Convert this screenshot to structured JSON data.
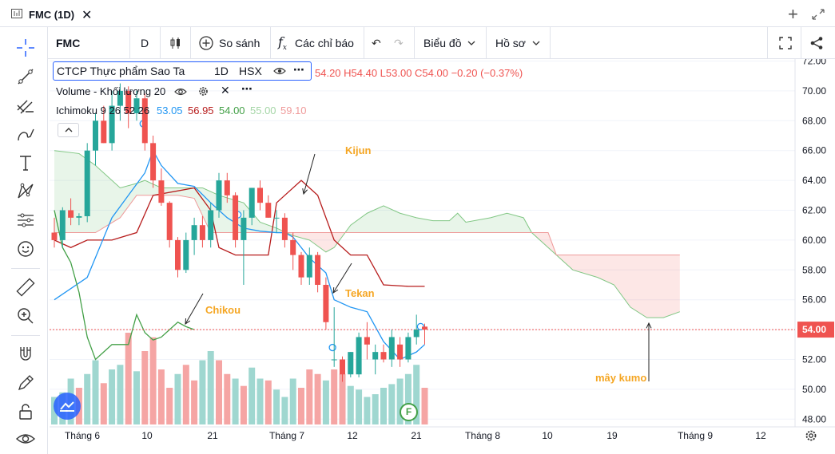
{
  "window": {
    "title": "FMC (1D)"
  },
  "toolbar": {
    "symbol": "FMC",
    "interval": "D",
    "compare": "So sánh",
    "indicators": "Các chỉ báo",
    "chart_type": "Biểu đồ",
    "profile": "Hồ sơ"
  },
  "legend": {
    "name": "CTCP Thực phẩm Sao Ta",
    "interval": "1D",
    "exchange": "HSX",
    "ohlc": "54.20  H54.40  L53.00  C54.00  −0.20 (−0.37%)",
    "volume_label": "Volume - Khối lượng 20",
    "ichimoku_label": "Ichimoku 9 26 52 26",
    "ichimoku_values": [
      "53.05",
      "56.95",
      "54.00",
      "55.00",
      "59.10"
    ]
  },
  "annotations": {
    "kijun": "Kijun",
    "tekan": "Tekan",
    "chikou": "Chikou",
    "kumo": "mây kumo"
  },
  "colors": {
    "up": "#26a69a",
    "down": "#ef5350",
    "tenkan": "#2196f3",
    "kijun": "#b71c1c",
    "chikou": "#43a047",
    "span_a": "#81c784",
    "span_b": "#ef9a9a",
    "annotation": "#f5a623"
  },
  "chart_data": {
    "type": "candlestick",
    "y_range": [
      47.5,
      72.2
    ],
    "y_ticks": [
      "72.00",
      "70.00",
      "68.00",
      "66.00",
      "64.00",
      "62.00",
      "60.00",
      "58.00",
      "56.00",
      "54.00",
      "52.00",
      "50.00",
      "48.00"
    ],
    "x_ticks": [
      "Tháng 6",
      "10",
      "21",
      "Tháng 7",
      "12",
      "21",
      "Tháng 8",
      "10",
      "19",
      "Tháng 9",
      "12"
    ],
    "last_price": "54.00",
    "candles": [
      [
        60.5,
        61.5,
        59.5,
        60.0
      ],
      [
        60.0,
        62.2,
        59.5,
        62.0
      ],
      [
        62.0,
        62.8,
        61.0,
        61.5
      ],
      [
        61.5,
        61.8,
        61.0,
        61.6
      ],
      [
        61.6,
        66.5,
        61.2,
        66.0
      ],
      [
        66.0,
        68.5,
        65.0,
        68.0
      ],
      [
        68.0,
        69.0,
        66.5,
        66.5
      ],
      [
        66.5,
        70.0,
        66.0,
        69.0
      ],
      [
        69.0,
        70.5,
        68.0,
        70.0
      ],
      [
        70.0,
        70.3,
        67.5,
        68.5
      ],
      [
        68.5,
        70.0,
        68.0,
        69.5
      ],
      [
        69.5,
        69.8,
        66.0,
        66.5
      ],
      [
        66.5,
        67.0,
        63.5,
        64.0
      ],
      [
        64.0,
        64.8,
        62.3,
        62.5
      ],
      [
        62.5,
        62.6,
        59.5,
        60.0
      ],
      [
        60.0,
        60.2,
        57.5,
        58.0
      ],
      [
        58.0,
        60.5,
        57.8,
        60.0
      ],
      [
        60.0,
        61.5,
        59.0,
        61.0
      ],
      [
        61.0,
        61.6,
        59.5,
        60.0
      ],
      [
        60.0,
        62.5,
        59.5,
        62.0
      ],
      [
        62.0,
        64.5,
        61.5,
        64.0
      ],
      [
        64.0,
        64.5,
        62.5,
        63.0
      ],
      [
        63.0,
        63.2,
        59.5,
        60.0
      ],
      [
        60.0,
        62.0,
        57.0,
        61.5
      ],
      [
        61.5,
        63.5,
        61.0,
        63.5
      ],
      [
        63.5,
        64.0,
        62.0,
        62.5
      ],
      [
        62.5,
        63.0,
        61.5,
        61.5
      ],
      [
        61.5,
        62.0,
        60.5,
        61.5
      ],
      [
        61.5,
        61.8,
        59.5,
        60.0
      ],
      [
        60.0,
        60.5,
        58.0,
        59.0
      ],
      [
        59.0,
        59.2,
        57.0,
        57.5
      ],
      [
        57.5,
        59.5,
        57.0,
        59.0
      ],
      [
        59.0,
        59.2,
        56.5,
        57.0
      ],
      [
        57.0,
        57.5,
        54.0,
        54.5
      ],
      [
        52.0,
        55.5,
        51.5,
        52.0
      ],
      [
        52.0,
        52.2,
        50.5,
        51.0
      ],
      [
        51.0,
        52.5,
        50.8,
        52.5
      ],
      [
        51.0,
        53.8,
        50.8,
        53.5
      ],
      [
        53.5,
        54.5,
        52.0,
        53.0
      ],
      [
        52.0,
        53.0,
        51.0,
        52.5
      ],
      [
        52.5,
        53.0,
        51.8,
        52.0
      ],
      [
        52.0,
        54.0,
        51.5,
        53.5
      ],
      [
        53.0,
        53.5,
        51.5,
        52.0
      ],
      [
        52.0,
        53.8,
        51.8,
        53.5
      ],
      [
        53.5,
        55.0,
        53.0,
        54.0
      ],
      [
        54.2,
        54.4,
        53.0,
        54.0
      ]
    ],
    "volume": [
      [
        30,
        1
      ],
      [
        35,
        1
      ],
      [
        50,
        1
      ],
      [
        40,
        0
      ],
      [
        55,
        1
      ],
      [
        70,
        1
      ],
      [
        45,
        0
      ],
      [
        60,
        1
      ],
      [
        65,
        1
      ],
      [
        100,
        0
      ],
      [
        58,
        1
      ],
      [
        80,
        0
      ],
      [
        95,
        0
      ],
      [
        60,
        0
      ],
      [
        40,
        0
      ],
      [
        55,
        1
      ],
      [
        65,
        0
      ],
      [
        48,
        0
      ],
      [
        70,
        1
      ],
      [
        80,
        1
      ],
      [
        70,
        0
      ],
      [
        55,
        0
      ],
      [
        50,
        1
      ],
      [
        42,
        0
      ],
      [
        62,
        1
      ],
      [
        50,
        1
      ],
      [
        48,
        0
      ],
      [
        38,
        1
      ],
      [
        30,
        1
      ],
      [
        50,
        1
      ],
      [
        40,
        0
      ],
      [
        60,
        0
      ],
      [
        55,
        0
      ],
      [
        48,
        1
      ],
      [
        60,
        0
      ],
      [
        55,
        0
      ],
      [
        42,
        1
      ],
      [
        38,
        1
      ],
      [
        30,
        1
      ],
      [
        33,
        1
      ],
      [
        40,
        1
      ],
      [
        44,
        1
      ],
      [
        50,
        1
      ],
      [
        55,
        1
      ],
      [
        65,
        1
      ],
      [
        40,
        0
      ]
    ],
    "tenkan": [
      [
        0,
        56.0
      ],
      [
        4,
        57.5
      ],
      [
        7,
        61.5
      ],
      [
        9,
        63.0
      ],
      [
        11,
        64.5
      ],
      [
        12,
        66.0
      ],
      [
        13,
        65.0
      ],
      [
        15,
        63.8
      ],
      [
        17,
        63.6
      ],
      [
        19,
        62.5
      ],
      [
        21,
        61.5
      ],
      [
        23,
        60.8
      ],
      [
        25,
        60.6
      ],
      [
        27,
        60.5
      ],
      [
        28,
        60.5
      ],
      [
        29,
        60.2
      ],
      [
        31,
        58.8
      ],
      [
        33,
        57.8
      ],
      [
        34,
        56.0
      ],
      [
        36,
        55.5
      ],
      [
        38,
        55.2
      ],
      [
        40,
        53.2
      ],
      [
        42,
        52.0
      ],
      [
        44,
        52.5
      ],
      [
        45,
        53.0
      ]
    ],
    "kijun": [
      [
        0,
        60.0
      ],
      [
        2,
        59.5
      ],
      [
        4,
        60.0
      ],
      [
        7,
        60.0
      ],
      [
        10,
        60.5
      ],
      [
        12,
        63.0
      ],
      [
        17,
        63.5
      ],
      [
        19,
        62.0
      ],
      [
        20,
        59.5
      ],
      [
        22,
        59.0
      ],
      [
        26,
        59.0
      ],
      [
        27,
        62.5
      ],
      [
        28,
        63.0
      ],
      [
        30,
        64.0
      ],
      [
        32,
        63.0
      ],
      [
        34,
        60.0
      ],
      [
        36,
        59.0
      ],
      [
        38,
        59.0
      ],
      [
        40,
        57.0
      ],
      [
        43,
        56.9
      ],
      [
        45,
        56.9
      ]
    ],
    "chikou": [
      [
        0,
        62.0
      ],
      [
        1,
        59.5
      ],
      [
        2,
        58.5
      ],
      [
        3,
        56.5
      ],
      [
        4,
        53.5
      ],
      [
        5,
        52.0
      ],
      [
        6,
        52.5
      ],
      [
        7,
        53.0
      ],
      [
        9,
        53.0
      ],
      [
        10,
        55.0
      ],
      [
        11,
        53.8
      ],
      [
        12,
        53.3
      ],
      [
        13,
        53.5
      ],
      [
        14,
        54.0
      ],
      [
        15,
        54.5
      ],
      [
        16,
        54.2
      ],
      [
        17,
        54.0
      ]
    ],
    "span_a": [
      [
        0,
        66.0
      ],
      [
        3,
        65.8
      ],
      [
        5,
        65.0
      ],
      [
        8,
        63.5
      ],
      [
        10,
        63.8
      ],
      [
        11,
        64.0
      ],
      [
        13,
        63.5
      ],
      [
        15,
        63.5
      ],
      [
        18,
        63.5
      ],
      [
        20,
        63.0
      ],
      [
        23,
        62.5
      ],
      [
        25,
        61.2
      ],
      [
        27,
        60.8
      ],
      [
        29,
        60.3
      ],
      [
        31,
        60.0
      ],
      [
        33,
        59.2
      ],
      [
        34,
        59.5
      ],
      [
        36,
        61.0
      ],
      [
        38,
        61.8
      ],
      [
        40,
        62.3
      ],
      [
        42,
        61.8
      ],
      [
        44,
        61.5
      ],
      [
        46,
        61.3
      ],
      [
        48,
        61.3
      ],
      [
        49,
        61.8
      ],
      [
        50,
        61.2
      ],
      [
        53,
        61.5
      ],
      [
        55,
        61.8
      ],
      [
        57,
        61.5
      ],
      [
        58,
        60.5
      ],
      [
        61,
        59.0
      ],
      [
        63,
        58.0
      ],
      [
        66,
        57.5
      ],
      [
        68,
        57.0
      ],
      [
        70,
        55.5
      ],
      [
        72,
        54.8
      ],
      [
        74,
        54.8
      ],
      [
        76,
        55.2
      ]
    ],
    "span_b": [
      [
        0,
        60.5
      ],
      [
        3,
        60.5
      ],
      [
        5,
        60.5
      ],
      [
        8,
        61.5
      ],
      [
        10,
        63.0
      ],
      [
        12,
        63.0
      ],
      [
        15,
        63.0
      ],
      [
        17,
        62.8
      ],
      [
        19,
        60.5
      ],
      [
        20,
        60.5
      ],
      [
        60,
        60.5
      ],
      [
        61,
        59.0
      ],
      [
        76,
        59.0
      ]
    ],
    "x_step": 10.3,
    "x_offset": 68
  }
}
